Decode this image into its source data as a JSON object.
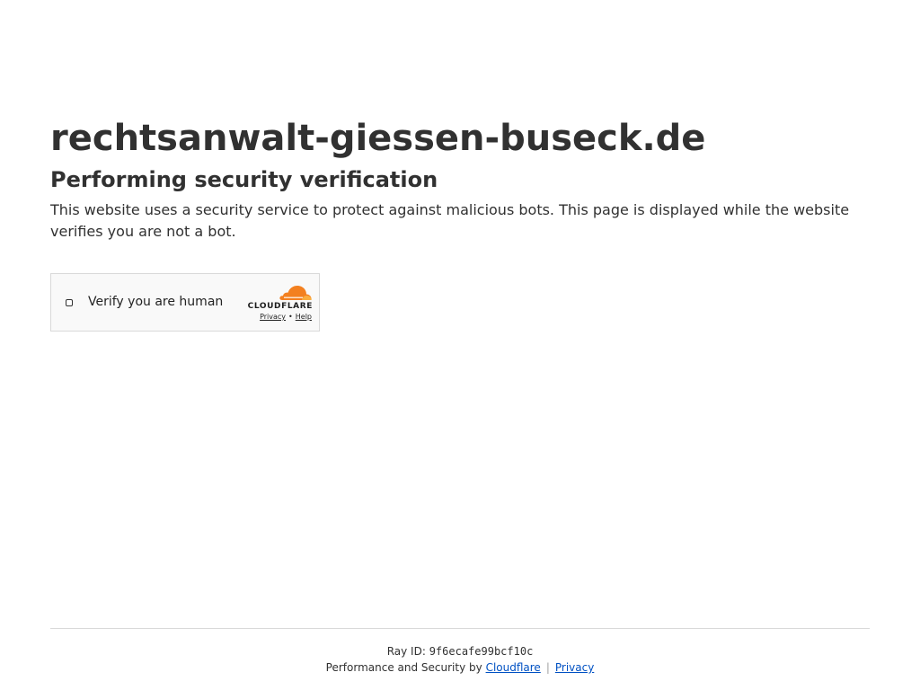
{
  "header": {
    "site_title": "rechtsanwalt-giessen-buseck.de",
    "subtitle": "Performing security verification",
    "description": "This website uses a security service to protect against malicious bots. This page is displayed while the website verifies you are not a bot."
  },
  "widget": {
    "checkbox_label": "Verify you are human",
    "brand_name": "CLOUDFLARE",
    "privacy_link": "Privacy",
    "separator": "•",
    "help_link": "Help"
  },
  "footer": {
    "ray_label": "Ray ID:",
    "ray_id": "9f6ecafe99bcf10c",
    "perf_text": "Performance and Security by",
    "cloudflare_link": "Cloudflare",
    "pipe": "|",
    "privacy_link": "Privacy"
  },
  "colors": {
    "text": "#313131",
    "link": "#0051c3",
    "cloud_orange": "#f38020",
    "cloud_light": "#faae40"
  },
  "icons": {
    "brand_icon": "cloudflare-cloud-icon"
  }
}
